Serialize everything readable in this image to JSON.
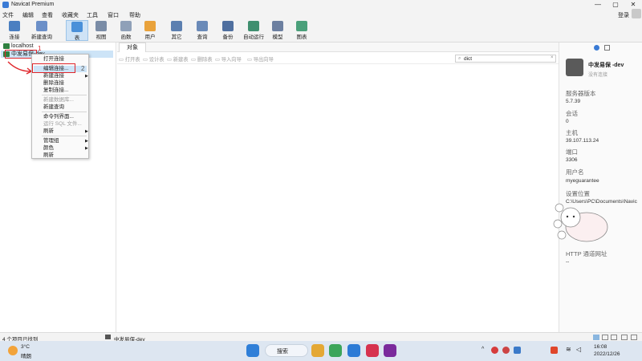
{
  "window": {
    "title": "Navicat Premium",
    "controls": [
      "—",
      "▢",
      "✕"
    ]
  },
  "menu": [
    "文件",
    "编辑",
    "查看",
    "收藏夹",
    "工具",
    "窗口",
    "帮助"
  ],
  "login_label": "登录",
  "toolbar": [
    {
      "label": "连接",
      "icon": "connection-icon",
      "color": "#4a7fc1"
    },
    {
      "label": "新建查询",
      "icon": "new-query-icon",
      "color": "#6b8fc8"
    },
    {
      "label": "表",
      "icon": "table-icon",
      "color": "#4a90d9"
    },
    {
      "label": "视图",
      "icon": "view-icon",
      "color": "#7a8ca6"
    },
    {
      "label": "函数",
      "icon": "function-icon",
      "color": "#8fa0b8"
    },
    {
      "label": "用户",
      "icon": "user-icon",
      "color": "#e9a23b"
    },
    {
      "label": "其它",
      "icon": "other-icon",
      "color": "#5b7fb0"
    },
    {
      "label": "查询",
      "icon": "query-icon",
      "color": "#6a8ab8"
    },
    {
      "label": "备份",
      "icon": "backup-icon",
      "color": "#4f6f9f"
    },
    {
      "label": "自动运行",
      "icon": "auto-run-icon",
      "color": "#3f8f6f"
    },
    {
      "label": "模型",
      "icon": "model-icon",
      "color": "#6c7fa0"
    },
    {
      "label": "图表",
      "icon": "chart-icon",
      "color": "#4aa07a"
    }
  ],
  "connections": [
    {
      "name": "localhost"
    },
    {
      "name": "中发易保-dev"
    }
  ],
  "context_menu": [
    {
      "label": "打开连接",
      "disabled": false
    },
    {
      "label": "编辑连接...",
      "disabled": false,
      "highlight": true
    },
    {
      "label": "新建连接",
      "disabled": false,
      "submenu": true
    },
    {
      "label": "删除连接",
      "disabled": false
    },
    {
      "label": "复制连接...",
      "disabled": false
    },
    {
      "label": "新建数据库...",
      "disabled": true
    },
    {
      "label": "新建查询",
      "disabled": false
    },
    {
      "label": "命令列界面...",
      "disabled": false
    },
    {
      "label": "运行 SQL 文件...",
      "disabled": true
    },
    {
      "label": "刷新",
      "disabled": false,
      "submenu": true
    },
    {
      "label": "管理组",
      "disabled": false,
      "submenu": true
    },
    {
      "label": "颜色",
      "disabled": false,
      "submenu": true
    },
    {
      "label": "刷新",
      "disabled": false
    }
  ],
  "annotations": {
    "step1": "1",
    "step2": "2"
  },
  "main": {
    "tab": "对象",
    "actions": [
      "打开表",
      "设计表",
      "新建表",
      "删除表",
      "导入向导",
      "导出向导"
    ],
    "search_value": "dict"
  },
  "info_panel": {
    "name": "中发易保 -dev",
    "status": "没有连接",
    "fields": [
      {
        "label": "服务器版本",
        "value": "5.7.39"
      },
      {
        "label": "会话",
        "value": "0"
      },
      {
        "label": "主机",
        "value": "39.107.113.24"
      },
      {
        "label": "端口",
        "value": "3306"
      },
      {
        "label": "用户名",
        "value": "myeguarantee"
      },
      {
        "label": "设置位置",
        "value": "C:\\Users\\PC\\Documents\\Navic"
      },
      {
        "label": "HTTP 通道网址",
        "value": "--"
      }
    ]
  },
  "status": {
    "left": "4 个项目已找到",
    "conn": "中发易保-dev"
  },
  "taskbar": {
    "weather_temp": "3°C",
    "weather_desc": "晴朗",
    "search_label": "搜索",
    "time": "16:08",
    "date": "2022/12/26"
  }
}
